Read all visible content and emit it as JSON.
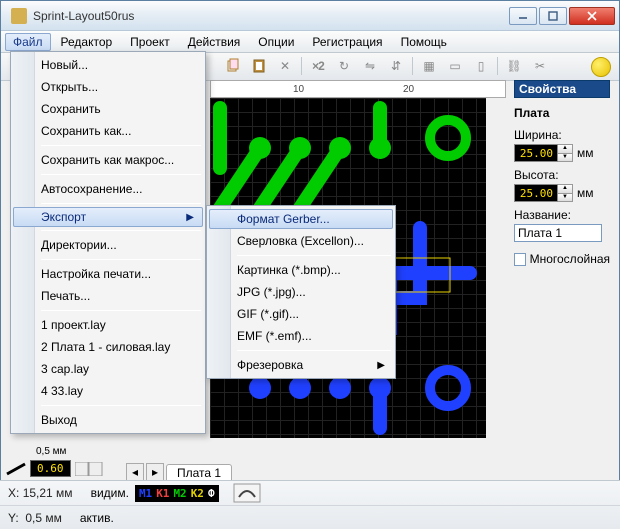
{
  "window": {
    "title": "Sprint-Layout50rus"
  },
  "menubar": [
    "Файл",
    "Редактор",
    "Проект",
    "Действия",
    "Опции",
    "Регистрация",
    "Помощь"
  ],
  "toolbar": {
    "x2": "×2"
  },
  "ruler": {
    "t10": "10",
    "t20": "20"
  },
  "props": {
    "header": "Свойства",
    "title": "Плата",
    "width_lbl": "Ширина:",
    "width_val": "25.00",
    "height_lbl": "Высота:",
    "height_val": "25.00",
    "unit": "мм",
    "name_lbl": "Название:",
    "name_val": "Плата 1",
    "multi": "Многослойная"
  },
  "file_menu": {
    "new": "Новый...",
    "open": "Открыть...",
    "save": "Сохранить",
    "saveas": "Сохранить как...",
    "savemacro": "Сохранить как макрос...",
    "autosave": "Автосохранение...",
    "export": "Экспорт",
    "dirs": "Директории...",
    "printsetup": "Настройка печати...",
    "print": "Печать...",
    "recent1": "1 проект.lay",
    "recent2": "2 Плата 1 - силовая.lay",
    "recent3": "3 cap.lay",
    "recent4": "4 33.lay",
    "exit": "Выход"
  },
  "export_menu": {
    "gerber": "Формат Gerber...",
    "excellon": "Сверловка (Excellon)...",
    "bmp": "Картинка (*.bmp)...",
    "jpg": "JPG (*.jpg)...",
    "gif": "GIF (*.gif)...",
    "emf": "EMF (*.emf)...",
    "mill": "Фрезеровка"
  },
  "tabs": {
    "board1": "Плата 1"
  },
  "leftbar": {
    "dim": "0.60",
    "half": "0,5 мм"
  },
  "status": {
    "x_lbl": "X:",
    "x_val": "15,21 мм",
    "y_lbl": "Y:",
    "y_val": "0,5 мм",
    "vis": "видим.",
    "act": "актив.",
    "m1": "М1",
    "k1": "К1",
    "m2": "М2",
    "k2": "К2",
    "f": "Ф"
  }
}
